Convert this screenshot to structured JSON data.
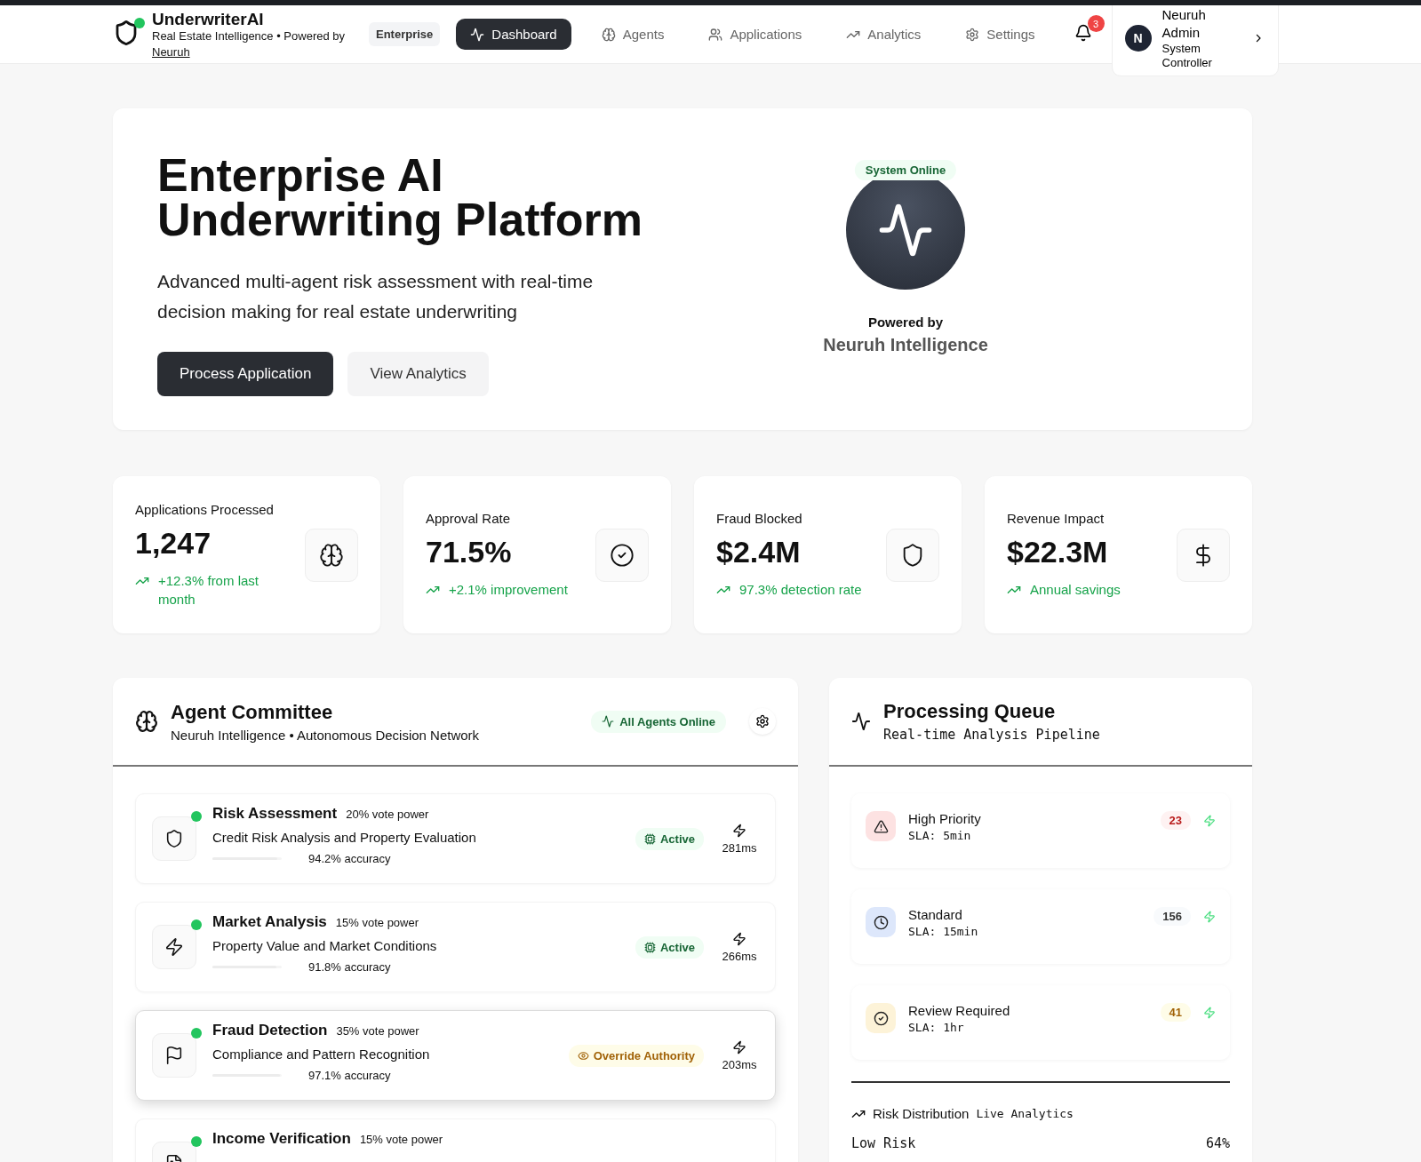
{
  "brand": {
    "name": "UnderwriterAI",
    "tagline": "Real Estate Intelligence • Powered by",
    "link": "Neuruh",
    "online": true
  },
  "nav": {
    "badge": "Enterprise",
    "items": [
      {
        "label": "Dashboard",
        "selected": true
      },
      {
        "label": "Agents",
        "selected": false
      },
      {
        "label": "Applications",
        "selected": false
      },
      {
        "label": "Analytics",
        "selected": false
      },
      {
        "label": "Settings",
        "selected": false
      }
    ],
    "notifications": "3",
    "user": {
      "initial": "N",
      "name": "Neuruh Admin",
      "role": "System Controller"
    }
  },
  "hero": {
    "title": "Enterprise AI Underwriting Platform",
    "subtitle": "Advanced multi-agent risk assessment with real-time decision making for real estate underwriting",
    "primary_button": "Process Application",
    "secondary_button": "View Analytics",
    "status": "System Online",
    "powered_label": "Powered by",
    "powered_name": "Neuruh Intelligence"
  },
  "stats": [
    {
      "label": "Applications Processed",
      "value": "1,247",
      "change": "+12.3% from last month"
    },
    {
      "label": "Approval Rate",
      "value": "71.5%",
      "change": "+2.1% improvement"
    },
    {
      "label": "Fraud Blocked",
      "value": "$2.4M",
      "change": "97.3% detection rate"
    },
    {
      "label": "Revenue Impact",
      "value": "$22.3M",
      "change": "Annual savings"
    }
  ],
  "agent_committee": {
    "title": "Agent Committee",
    "subtitle": "Neuruh Intelligence • Autonomous Decision Network",
    "status": "All Agents Online",
    "agents": [
      {
        "name": "Risk Assessment",
        "vote_power": "20% vote power",
        "description": "Credit Risk Analysis and Property Evaluation",
        "accuracy": "94.2% accuracy",
        "level": 0.942,
        "status": "Active",
        "kind": "active",
        "latency": "281ms",
        "online": true,
        "highlighted": false
      },
      {
        "name": "Market Analysis",
        "vote_power": "15% vote power",
        "description": "Property Value and Market Conditions",
        "accuracy": "91.8% accuracy",
        "level": 0.918,
        "status": "Active",
        "kind": "active",
        "latency": "266ms",
        "online": true,
        "highlighted": false
      },
      {
        "name": "Fraud Detection",
        "vote_power": "35% vote power",
        "description": "Compliance and Pattern Recognition",
        "accuracy": "97.1% accuracy",
        "level": 0.971,
        "status": "Override Authority",
        "kind": "override",
        "latency": "203ms",
        "online": true,
        "highlighted": true
      },
      {
        "name": "Income Verification",
        "vote_power": "15% vote power",
        "online": true,
        "highlighted": false
      }
    ]
  },
  "processing_queue": {
    "title": "Processing Queue",
    "subtitle": "Real-time Analysis Pipeline",
    "items": [
      {
        "name": "High Priority",
        "sla": "SLA: 5min",
        "count": "23",
        "kind": "high"
      },
      {
        "name": "Standard",
        "sla": "SLA: 15min",
        "count": "156",
        "kind": "standard"
      },
      {
        "name": "Review Required",
        "sla": "SLA: 1hr",
        "count": "41",
        "kind": "review"
      }
    ],
    "risk_distribution": {
      "title": "Risk Distribution",
      "subtitle": "Live Analytics",
      "rows": [
        {
          "label": "Low Risk",
          "value": "64%"
        }
      ]
    }
  }
}
